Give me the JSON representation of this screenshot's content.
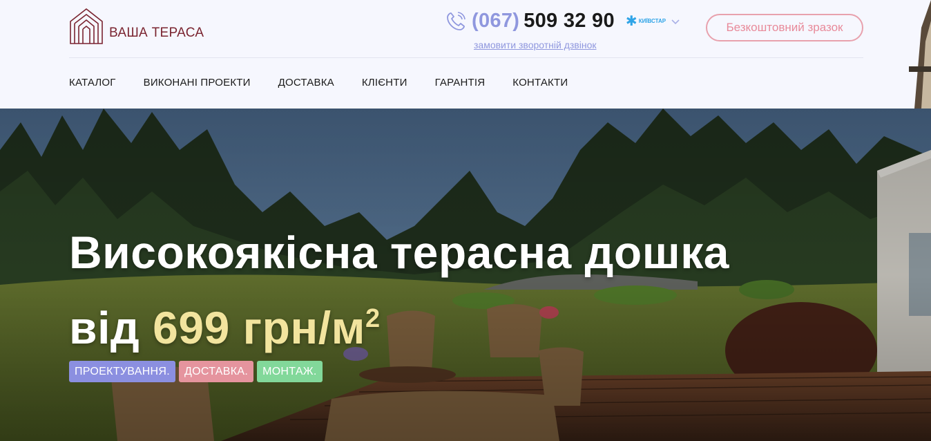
{
  "header": {
    "logo_text": "ВАША ТЕРАСА",
    "phone_code": "(067)",
    "phone_number": "509 32 90",
    "operator": "КИЇВСТАР",
    "callback_link": "замовити зворотній дзвінок",
    "sample_button": "Безкоштовний зразок"
  },
  "nav": {
    "items": [
      {
        "label": "КАТАЛОГ"
      },
      {
        "label": "ВИКОНАНІ ПРОЕКТИ"
      },
      {
        "label": "ДОСТАВКА"
      },
      {
        "label": "КЛІЄНТИ"
      },
      {
        "label": "ГАРАНТІЯ"
      },
      {
        "label": "КОНТАКТИ"
      }
    ]
  },
  "hero": {
    "title_line1": "Високоякісна терасна дошка",
    "title_prefix": "від",
    "price": "699 грн/м",
    "price_superscript": "2",
    "tags": [
      {
        "label": "ПРОЕКТУВАННЯ.",
        "color": "#8b8fe0"
      },
      {
        "label": "ДОСТАВКА.",
        "color": "#e5949e"
      },
      {
        "label": "МОНТАЖ.",
        "color": "#82d89a"
      }
    ]
  },
  "colors": {
    "accent_blue": "#8f97de",
    "accent_pink": "#e88a9a",
    "brand_maroon": "#7a2430",
    "price_yellow": "#f2e49e",
    "header_bg": "#f6f7fe"
  },
  "icons": [
    "house-logo-icon",
    "phone-icon",
    "kyivstar-star-icon",
    "chevron-down-icon"
  ]
}
